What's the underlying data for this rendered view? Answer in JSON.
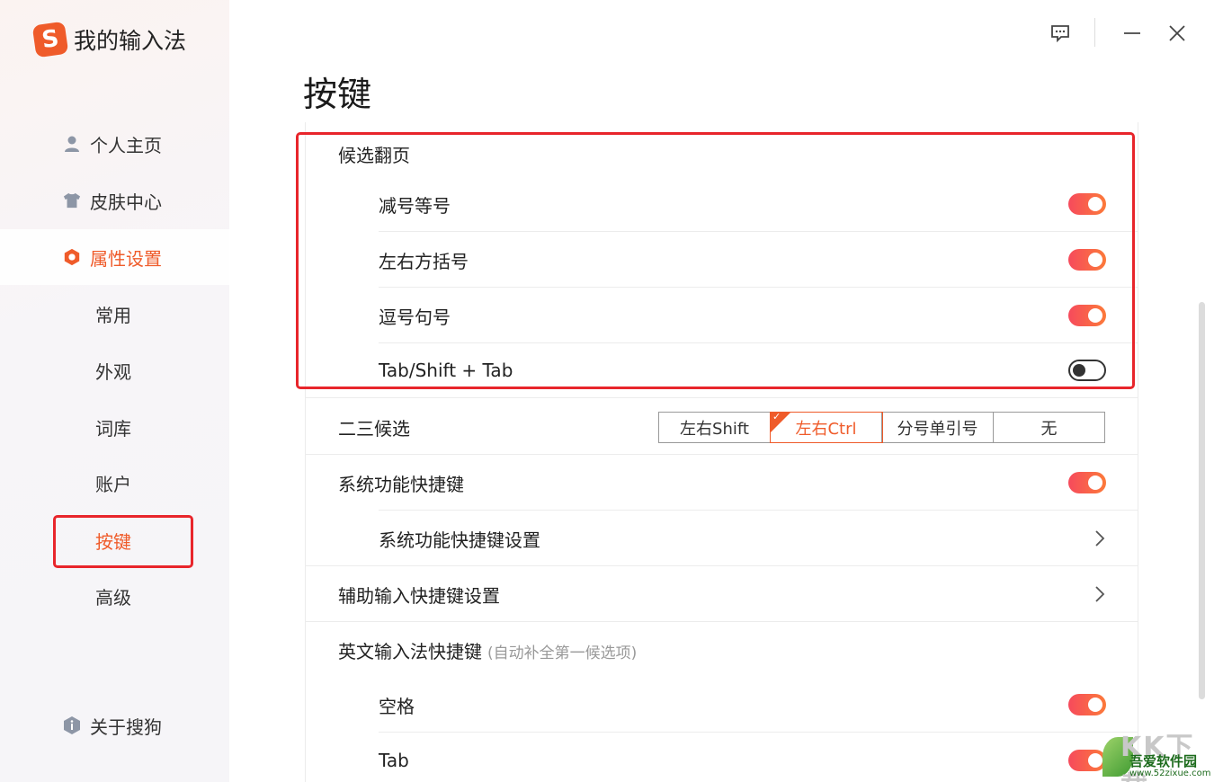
{
  "app": {
    "logo_glyph": "S",
    "title": "我的输入法"
  },
  "sidebar": {
    "nav": [
      {
        "label": "个人主页",
        "icon": "person-icon"
      },
      {
        "label": "皮肤中心",
        "icon": "shirt-icon"
      },
      {
        "label": "属性设置",
        "icon": "hexagon-settings-icon",
        "active": true
      }
    ],
    "sub_items": [
      {
        "label": "常用"
      },
      {
        "label": "外观"
      },
      {
        "label": "词库"
      },
      {
        "label": "账户"
      },
      {
        "label": "按键",
        "active": true
      },
      {
        "label": "高级"
      }
    ],
    "about": {
      "label": "关于搜狗",
      "icon": "info-shield-icon"
    }
  },
  "titlebar": {
    "feedback_icon": "feedback-icon",
    "minimize_icon": "minimize-icon",
    "close_icon": "close-icon"
  },
  "main": {
    "title": "按键",
    "candidate_paging": {
      "header": "候选翻页",
      "items": [
        {
          "label": "减号等号",
          "on": true
        },
        {
          "label": "左右方括号",
          "on": true
        },
        {
          "label": "逗号句号",
          "on": true
        },
        {
          "label": "Tab/Shift + Tab",
          "on": false
        }
      ]
    },
    "second_third": {
      "label": "二三候选",
      "options": [
        "左右Shift",
        "左右Ctrl",
        "分号单引号",
        "无"
      ],
      "selected": "左右Ctrl"
    },
    "sys_shortcut": {
      "label": "系统功能快捷键",
      "on": true
    },
    "sys_shortcut_settings": {
      "label": "系统功能快捷键设置"
    },
    "aux_input_settings": {
      "label": "辅助输入快捷键设置"
    },
    "english_shortcut": {
      "label": "英文输入法快捷键",
      "hint": "(自动补全第一候选项)",
      "items": [
        {
          "label": "空格",
          "on": true
        },
        {
          "label": "Tab",
          "on": true
        }
      ]
    }
  },
  "colors": {
    "accent": "#ef5b2a",
    "highlight_box": "#e8252b",
    "toggle_on_start": "#f64a5c",
    "toggle_on_end": "#fc7a3a"
  },
  "watermark": {
    "top": "KK下载",
    "main": "吾爱软件园",
    "url": "www.52zixue.com"
  }
}
